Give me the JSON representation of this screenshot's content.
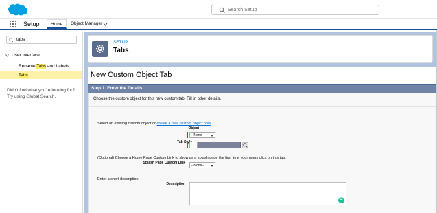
{
  "top": {
    "search_placeholder": "Search Setup"
  },
  "nav": {
    "app_name": "Setup",
    "tabs": [
      {
        "label": "Home"
      },
      {
        "label": "Object Manager"
      }
    ]
  },
  "sidebar": {
    "quickfind_value": "tabs",
    "parent": "User Interface",
    "items": [
      {
        "label_pre": "Rename ",
        "label_hl": "Tabs",
        "label_post": " and Labels"
      },
      {
        "label_pre": "",
        "label_hl": "Tabs",
        "label_post": ""
      }
    ],
    "not_found": "Didn't find what you're looking for? Try using Global Search."
  },
  "header": {
    "section": "SETUP",
    "title": "Tabs"
  },
  "page": {
    "title": "New Custom Object Tab",
    "step": "Step 1. Enter the Details",
    "intro": "Choose the custom object for this new custom tab. Fill in other details.",
    "select_prompt_pre": "Select an existing custom object or ",
    "select_prompt_link": "create a new custom object now",
    "select_prompt_post": ".",
    "object_label": "Object",
    "object_value": "--None--",
    "tabstyle_label": "Tab Style",
    "optional_text": "(Optional) Choose a Home Page Custom Link to show as a splash page the first time your users click on this tab.",
    "splash_label": "Splash Page Custom Link",
    "splash_value": "--None--",
    "desc_prompt": "Enter a short description.",
    "desc_label": "Description"
  },
  "colors": {
    "brand": "#1b5297",
    "main_bg": "#b0c4df",
    "step_bar": "#6f84a6",
    "link": "#0070d2",
    "required": "#c23934",
    "highlight": "#fbe96a"
  },
  "icons": [
    "salesforce-cloud-logo",
    "search-icon",
    "app-launcher-icon",
    "chevron-down-icon",
    "gear-icon",
    "lookup-icon",
    "grammarly-icon"
  ]
}
